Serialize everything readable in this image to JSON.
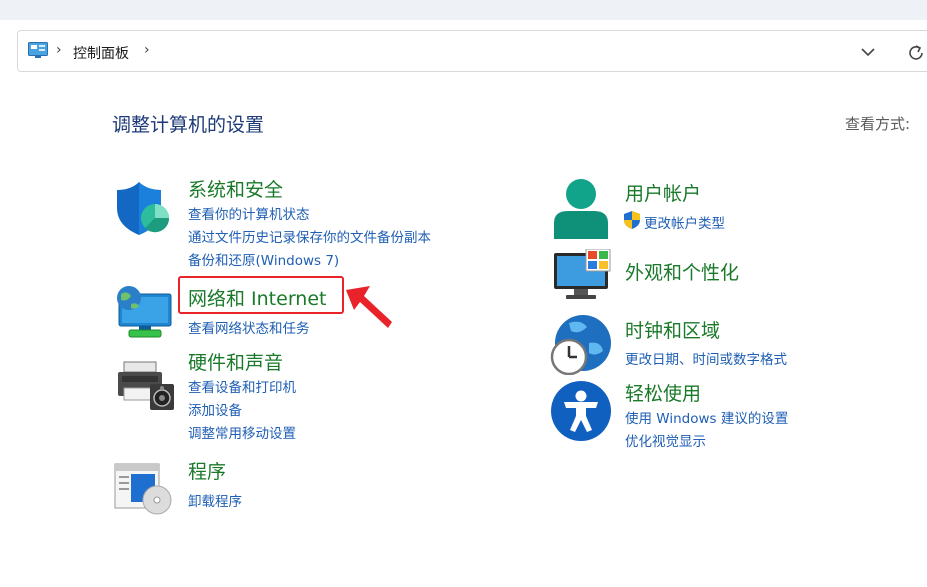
{
  "breadcrumb": {
    "root_icon": "control-panel-icon",
    "item": "控制面板"
  },
  "header": {
    "title": "调整计算机的设置",
    "view_by_label": "查看方式:"
  },
  "categories": {
    "system_security": {
      "icon": "shield-icon",
      "title": "系统和安全",
      "links": [
        "查看你的计算机状态",
        "通过文件历史记录保存你的文件备份副本",
        "备份和还原(Windows 7)"
      ]
    },
    "network": {
      "icon": "network-globe-icon",
      "title": "网络和 Internet",
      "links": [
        "查看网络状态和任务"
      ]
    },
    "hardware_sound": {
      "icon": "printer-speaker-icon",
      "title": "硬件和声音",
      "links": [
        "查看设备和打印机",
        "添加设备",
        "调整常用移动设置"
      ]
    },
    "programs": {
      "icon": "programs-disc-icon",
      "title": "程序",
      "links": [
        "卸载程序"
      ]
    },
    "user_accounts": {
      "icon": "user-icon",
      "title": "用户帐户",
      "links": [
        "更改帐户类型"
      ]
    },
    "appearance": {
      "icon": "monitor-personalize-icon",
      "title": "外观和个性化",
      "links": []
    },
    "clock_region": {
      "icon": "clock-globe-icon",
      "title": "时钟和区域",
      "links": [
        "更改日期、时间或数字格式"
      ]
    },
    "ease_of_access": {
      "icon": "accessibility-icon",
      "title": "轻松使用",
      "links": [
        "使用 Windows 建议的设置",
        "优化视觉显示"
      ]
    }
  },
  "colors": {
    "category_title": "#1a7a2a",
    "link": "#1f5fb4",
    "highlight": "#e8232a",
    "page_title": "#1e3a78"
  }
}
